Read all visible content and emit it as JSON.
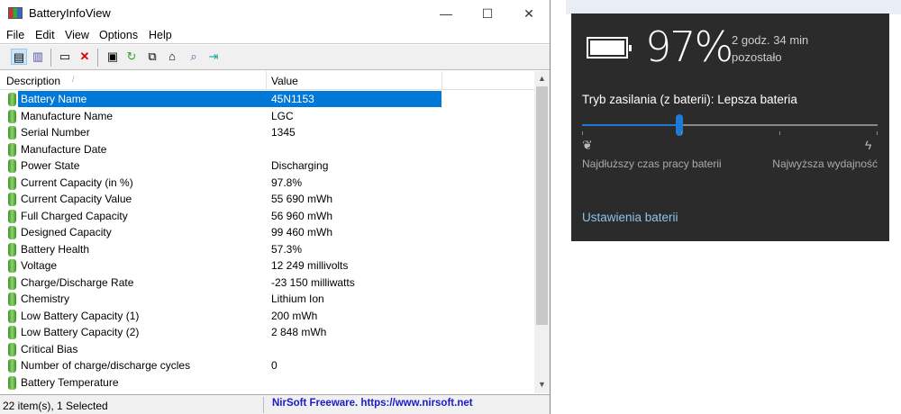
{
  "window": {
    "title": "BatteryInfoView",
    "minimize": "—",
    "maximize": "☐",
    "close": "✕"
  },
  "menu": [
    "File",
    "Edit",
    "View",
    "Options",
    "Help"
  ],
  "toolbar_icons": [
    "properties-icon",
    "html-report-icon",
    "choose-columns-icon",
    "delete-icon",
    "save-icon",
    "refresh-icon",
    "copy-icon",
    "properties-window-icon",
    "find-icon",
    "exit-icon"
  ],
  "columns": {
    "description": "Description",
    "value": "Value"
  },
  "rows": [
    {
      "description": "Battery Name",
      "value": "45N1153",
      "selected": true
    },
    {
      "description": "Manufacture Name",
      "value": "LGC"
    },
    {
      "description": "Serial Number",
      "value": " 1345"
    },
    {
      "description": "Manufacture Date",
      "value": ""
    },
    {
      "description": "Power State",
      "value": "Discharging"
    },
    {
      "description": "Current Capacity (in %)",
      "value": "97.8%"
    },
    {
      "description": "Current Capacity Value",
      "value": "55 690 mWh"
    },
    {
      "description": "Full Charged Capacity",
      "value": "56 960 mWh"
    },
    {
      "description": "Designed Capacity",
      "value": "99 460 mWh"
    },
    {
      "description": "Battery Health",
      "value": "57.3%"
    },
    {
      "description": "Voltage",
      "value": "12 249 millivolts"
    },
    {
      "description": "Charge/Discharge Rate",
      "value": "-23 150 milliwatts"
    },
    {
      "description": "Chemistry",
      "value": "Lithium Ion"
    },
    {
      "description": "Low Battery Capacity (1)",
      "value": "200 mWh"
    },
    {
      "description": "Low Battery Capacity (2)",
      "value": "2 848 mWh"
    },
    {
      "description": "Critical Bias",
      "value": ""
    },
    {
      "description": "Number of charge/discharge cycles",
      "value": "0"
    },
    {
      "description": "Battery Temperature",
      "value": ""
    }
  ],
  "status": {
    "items": "22 item(s), 1 Selected",
    "credit": "NirSoft Freeware. https://www.nirsoft.net"
  },
  "flyout": {
    "percent": "97%",
    "remaining_line1": "2 godz. 34 min",
    "remaining_line2": "pozostało",
    "mode": "Tryb zasilania (z baterii): Lepsza bateria",
    "slider_position": 0.33,
    "left_label": "Najdłuższy czas pracy baterii",
    "right_label": "Najwyższa wydajność",
    "settings_link": "Ustawienia baterii",
    "accent": "#1e7ad6"
  }
}
